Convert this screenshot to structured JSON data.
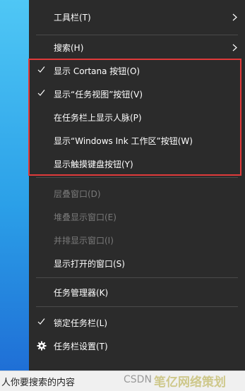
{
  "menu": {
    "toolbar_label": "工具栏(T)",
    "search_label": "搜索(H)",
    "show_cortana_label": "显示 Cortana 按钮(O)",
    "show_task_view_label": "显示“任务视图”按钮(V)",
    "show_people_label": "在任务栏上显示人脉(P)",
    "show_ink_label": "显示“Windows Ink 工作区”按钮(W)",
    "show_touch_keyboard_label": "显示触摸键盘按钮(Y)",
    "cascade_label": "层叠窗口(D)",
    "stacked_label": "堆叠显示窗口(E)",
    "side_by_side_label": "并排显示窗口(I)",
    "show_desktop_windows_label": "显示打开的窗口(S)",
    "task_manager_label": "任务管理器(K)",
    "lock_taskbar_label": "锁定任务栏(L)",
    "taskbar_settings_label": "任务栏设置(T)",
    "checked": {
      "show_cortana": true,
      "show_task_view": true,
      "lock_taskbar": true
    },
    "disabled": [
      "cascade",
      "stacked",
      "side_by_side"
    ]
  },
  "taskbar": {
    "search_text": "人你要搜索的内容",
    "watermark_a": "CSDN",
    "watermark_b": "笔亿网络策划"
  },
  "colors": {
    "menu_bg": "#2b2b2b",
    "menu_text": "#ffffff",
    "disabled_text": "#7a7a7a",
    "highlight_border": "#e03a3a",
    "hover_bg": "#414141"
  },
  "icons": {
    "check": "checkmark-icon",
    "chevron": "chevron-right-icon",
    "gear": "gear-icon"
  }
}
